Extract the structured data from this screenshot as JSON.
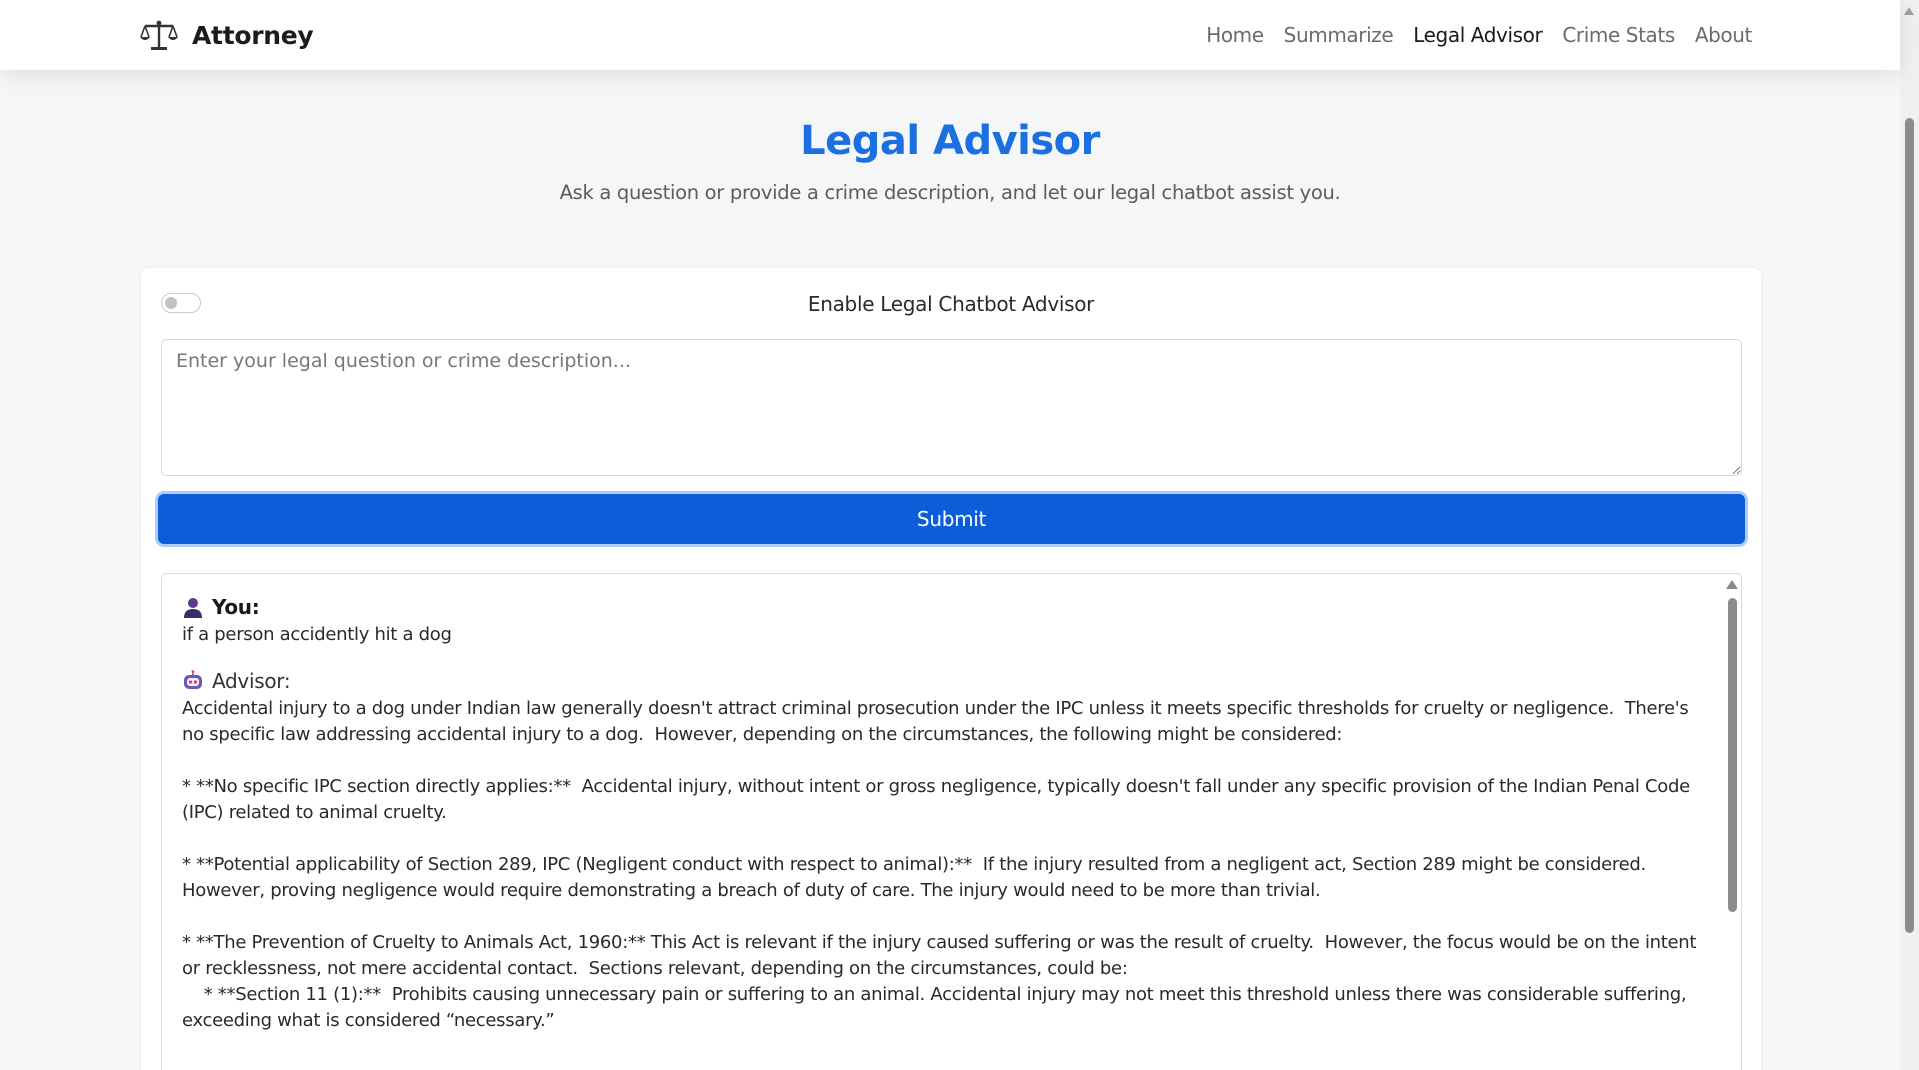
{
  "navbar": {
    "brand": "Attorney",
    "brand_icon": "scales-of-justice-icon",
    "links": [
      "Home",
      "Summarize",
      "Legal Advisor",
      "Crime Stats",
      "About"
    ],
    "active": "Legal Advisor"
  },
  "hero": {
    "title": "Legal Advisor",
    "subtitle": "Ask a question or provide a crime description, and let our legal chatbot assist you."
  },
  "advisor_form": {
    "toggle_label": "Enable Legal Chatbot Advisor",
    "toggle_on": false,
    "input_placeholder": "Enter your legal question or crime description...",
    "input_value": "",
    "submit_label": "Submit"
  },
  "chat": {
    "user": {
      "label": "You:",
      "icon": "user-icon",
      "text": "if a person accidently hit a dog"
    },
    "advisor": {
      "label": "Advisor:",
      "icon": "robot-icon",
      "paragraphs": [
        "Accidental injury to a dog under Indian law generally doesn't attract criminal prosecution under the IPC unless it meets specific thresholds for cruelty or negligence.  There's no specific law addressing accidental injury to a dog.  However, depending on the circumstances, the following might be considered:",
        "* **No specific IPC section directly applies:**  Accidental injury, without intent or gross negligence, typically doesn't fall under any specific provision of the Indian Penal Code (IPC) related to animal cruelty.",
        "* **Potential applicability of Section 289, IPC (Negligent conduct with respect to animal):**  If the injury resulted from a negligent act, Section 289 might be considered.  However, proving negligence would require demonstrating a breach of duty of care. The injury would need to be more than trivial.",
        "* **The Prevention of Cruelty to Animals Act, 1960:** This Act is relevant if the injury caused suffering or was the result of cruelty.  However, the focus would be on the intent or recklessness, not mere accidental contact.  Sections relevant, depending on the circumstances, could be:",
        "    * **Section 11 (1):**  Prohibits causing unnecessary pain or suffering to an animal. Accidental injury may not meet this threshold unless there was considerable suffering, exceeding what is considered “necessary.”"
      ]
    }
  },
  "colors": {
    "accent": "#1b6fe0",
    "button": "#0b5ed7",
    "background": "#f5f6f8"
  }
}
